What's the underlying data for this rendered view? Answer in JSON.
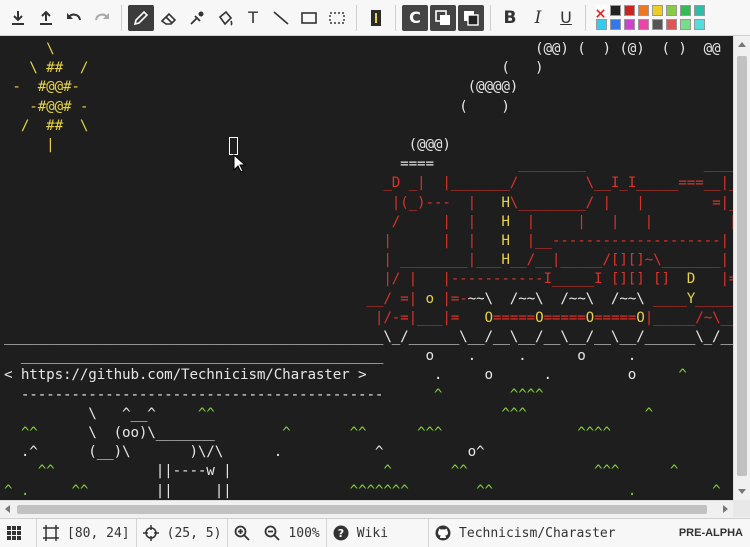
{
  "toolbar": {
    "buttons": [
      {
        "name": "export-icon"
      },
      {
        "name": "import-icon"
      },
      {
        "name": "undo-icon"
      },
      {
        "name": "redo-icon"
      }
    ],
    "tools": [
      {
        "name": "pencil-icon",
        "active": true
      },
      {
        "name": "eraser-icon"
      },
      {
        "name": "eyedropper-icon"
      },
      {
        "name": "fill-bucket-icon"
      }
    ],
    "text_tool": "T",
    "mode_c": "C",
    "bold": "B",
    "italic": "I",
    "underline": "U",
    "palette": [
      "#ffffff",
      "#222222",
      "#cc2222",
      "#ee7722",
      "#eecc22",
      "#88cc44",
      "#33bb55",
      "#33bbaa",
      "#33ccee",
      "#3377ee",
      "#cc44cc",
      "#ee44aa",
      "#555555",
      "#dd5555",
      "#77dd88",
      "#55dddd"
    ]
  },
  "canvas": {
    "url_banner": "< https://github.com/Technicism/Charaster >"
  },
  "status": {
    "grid_size": "[80, 24]",
    "cursor_pos": "(25, 5)",
    "zoom": "100%",
    "wiki_label": "Wiki",
    "repo_label": "Technicism/Charaster",
    "version": "PRE-ALPHA"
  }
}
